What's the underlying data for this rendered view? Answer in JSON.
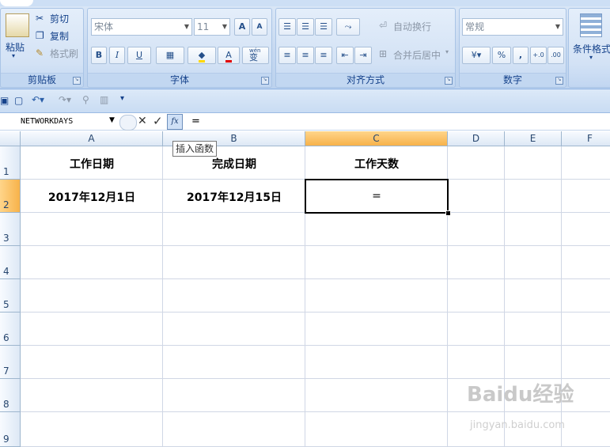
{
  "ribbon": {
    "clipboard": {
      "label": "剪贴板",
      "paste": "粘贴",
      "cut": "剪切",
      "copy": "复制",
      "format_painter": "格式刷"
    },
    "font": {
      "label": "字体",
      "font_name": "宋体",
      "font_size": "11",
      "grow": "A",
      "shrink": "A",
      "bold": "B",
      "italic": "I",
      "underline": "U",
      "wen": "wén",
      "wen_char": "变"
    },
    "alignment": {
      "label": "对齐方式",
      "wrap_text": "自动换行",
      "merge_center": "合并后居中"
    },
    "number": {
      "label": "数字",
      "format": "常规",
      "percent": "%",
      "comma": ",",
      "inc_decimal": "+.0",
      "dec_decimal": ".00"
    },
    "styles": {
      "conditional_format": "条件格式"
    }
  },
  "formula_bar": {
    "name_box": "NETWORKDAYS",
    "cancel": "✕",
    "enter": "✓",
    "fx": "fx",
    "content": "="
  },
  "tooltip": "插入函数",
  "columns": [
    "A",
    "B",
    "C",
    "D",
    "E",
    "F"
  ],
  "rows": [
    "1",
    "2",
    "3",
    "4",
    "5",
    "6",
    "7",
    "8",
    "9"
  ],
  "cells": {
    "A1": "工作日期",
    "B1": "完成日期",
    "C1": "工作天数",
    "A2": "2017年12月1日",
    "B2": "2017年12月15日",
    "C2": "="
  },
  "selected_column": "C",
  "selected_row": "2",
  "watermark": {
    "brand": "Baidu经验",
    "url": "jingyan.baidu.com"
  }
}
